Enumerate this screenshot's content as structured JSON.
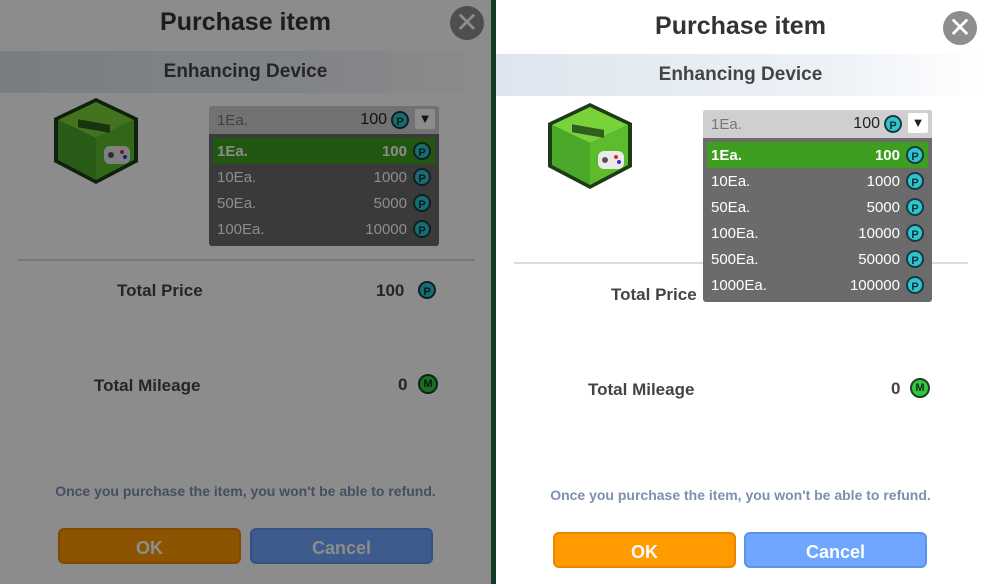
{
  "dialog": {
    "title": "Purchase item",
    "close_icon_label": "✕",
    "item_name": "Enhancing Device"
  },
  "dropdown": {
    "selected_qty": "1Ea.",
    "selected_price": "100",
    "currency_icon_text": "P",
    "left_options": [
      {
        "qty": "1Ea.",
        "price": "100"
      },
      {
        "qty": "10Ea.",
        "price": "1000"
      },
      {
        "qty": "50Ea.",
        "price": "5000"
      },
      {
        "qty": "100Ea.",
        "price": "10000"
      }
    ],
    "right_options": [
      {
        "qty": "1Ea.",
        "price": "100"
      },
      {
        "qty": "10Ea.",
        "price": "1000"
      },
      {
        "qty": "50Ea.",
        "price": "5000"
      },
      {
        "qty": "100Ea.",
        "price": "10000"
      },
      {
        "qty": "500Ea.",
        "price": "50000"
      },
      {
        "qty": "1000Ea.",
        "price": "100000"
      }
    ]
  },
  "totals": {
    "price_label": "Total Price",
    "price_value": "100",
    "mileage_label": "Total Mileage",
    "mileage_value": "0",
    "mileage_icon_text": "M"
  },
  "refund_note": "Once you purchase the item, you won't be able to refund.",
  "buttons": {
    "ok": "OK",
    "cancel": "Cancel"
  },
  "colors": {
    "ok": "#ff9a00",
    "cancel": "#6fa6ff",
    "selected_option": "#3e9e1f",
    "currency": "#2ec6cc",
    "mileage": "#36c540"
  }
}
